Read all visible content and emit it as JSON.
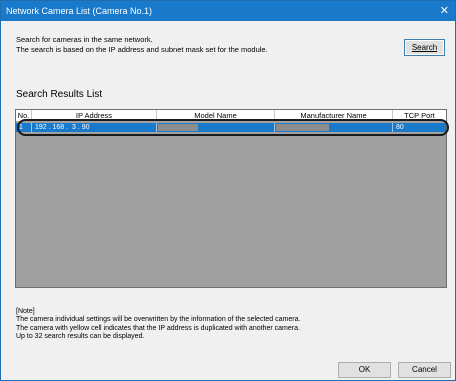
{
  "window": {
    "title": "Network Camera List (Camera No.1)",
    "close_glyph": "✕"
  },
  "description": [
    "Search for cameras in the same network.",
    "The search is based on the IP address and subnet mask set for the module."
  ],
  "search_button": "Search",
  "results_label": "Search Results List",
  "table": {
    "columns": [
      "No.",
      "IP Address",
      "Model Name",
      "Manufacturer Name",
      "TCP Port Number"
    ],
    "rows": [
      {
        "no": "1",
        "ip": "192 . 168 .  3 . 90",
        "model": "",
        "manufacturer": "",
        "port": "80"
      }
    ],
    "selected_row_color": "#1979ca"
  },
  "note": [
    "[Note]",
    "The camera individual settings will be overwritten by the information of the selected camera.",
    "The camera with yellow cell indicates that the IP address is duplicated with another camera.",
    "Up to 32 search results can be displayed."
  ],
  "buttons": {
    "ok": "OK",
    "cancel": "Cancel"
  },
  "colors": {
    "title_bar": "#1979ca",
    "table_background": "#a0a0a0",
    "dialog_background": "#f0f0f0"
  }
}
